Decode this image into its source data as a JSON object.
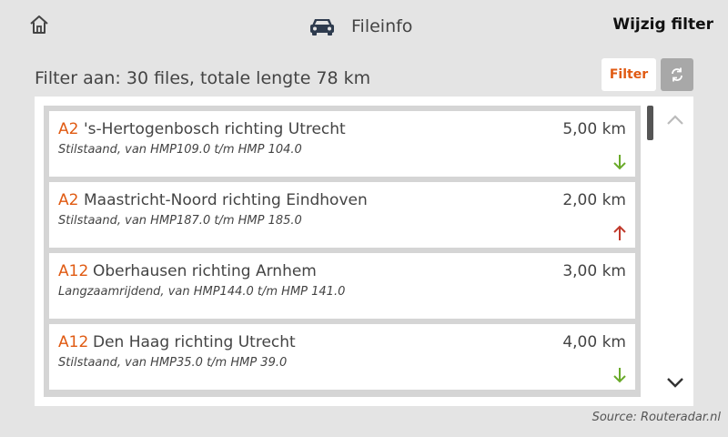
{
  "header": {
    "title": "Fileinfo",
    "edit_filter_label": "Wijzig filter"
  },
  "summary": "Filter aan: 30 files, totale lengte 78 km",
  "filter_button_label": "Filter",
  "items": [
    {
      "road": "A2",
      "route": "'s-Hertogenbosch richting Utrecht",
      "detail": "Stilstaand, van HMP109.0 t/m HMP 104.0",
      "length": "5,00 km",
      "trend": "down"
    },
    {
      "road": "A2",
      "route": "Maastricht-Noord richting Eindhoven",
      "detail": "Stilstaand, van HMP187.0 t/m HMP 185.0",
      "length": "2,00 km",
      "trend": "up"
    },
    {
      "road": "A12",
      "route": "Oberhausen richting Arnhem",
      "detail": "Langzaamrijdend, van HMP144.0 t/m HMP 141.0",
      "length": "3,00 km",
      "trend": "none"
    },
    {
      "road": "A12",
      "route": "Den Haag richting Utrecht",
      "detail": "Stilstaand, van HMP35.0 t/m HMP 39.0",
      "length": "4,00 km",
      "trend": "down"
    }
  ],
  "source": "Source: Routeradar.nl",
  "colors": {
    "accent": "#e05a12",
    "trend_down": "#6aaa2a",
    "trend_up": "#c0392b"
  }
}
